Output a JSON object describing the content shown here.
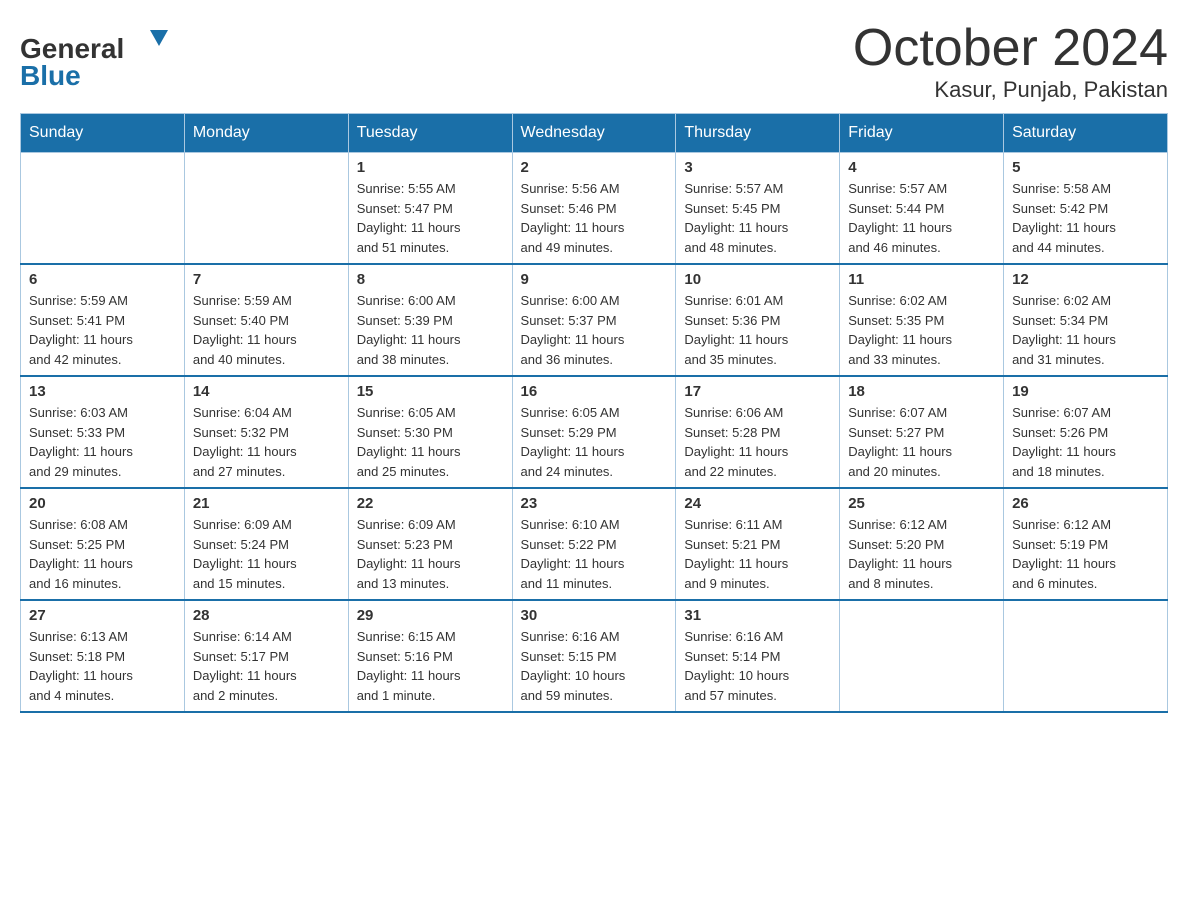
{
  "header": {
    "logo_general": "General",
    "logo_blue": "Blue",
    "title": "October 2024",
    "subtitle": "Kasur, Punjab, Pakistan"
  },
  "days_of_week": [
    "Sunday",
    "Monday",
    "Tuesday",
    "Wednesday",
    "Thursday",
    "Friday",
    "Saturday"
  ],
  "weeks": [
    [
      {
        "day": "",
        "info": ""
      },
      {
        "day": "",
        "info": ""
      },
      {
        "day": "1",
        "info": "Sunrise: 5:55 AM\nSunset: 5:47 PM\nDaylight: 11 hours\nand 51 minutes."
      },
      {
        "day": "2",
        "info": "Sunrise: 5:56 AM\nSunset: 5:46 PM\nDaylight: 11 hours\nand 49 minutes."
      },
      {
        "day": "3",
        "info": "Sunrise: 5:57 AM\nSunset: 5:45 PM\nDaylight: 11 hours\nand 48 minutes."
      },
      {
        "day": "4",
        "info": "Sunrise: 5:57 AM\nSunset: 5:44 PM\nDaylight: 11 hours\nand 46 minutes."
      },
      {
        "day": "5",
        "info": "Sunrise: 5:58 AM\nSunset: 5:42 PM\nDaylight: 11 hours\nand 44 minutes."
      }
    ],
    [
      {
        "day": "6",
        "info": "Sunrise: 5:59 AM\nSunset: 5:41 PM\nDaylight: 11 hours\nand 42 minutes."
      },
      {
        "day": "7",
        "info": "Sunrise: 5:59 AM\nSunset: 5:40 PM\nDaylight: 11 hours\nand 40 minutes."
      },
      {
        "day": "8",
        "info": "Sunrise: 6:00 AM\nSunset: 5:39 PM\nDaylight: 11 hours\nand 38 minutes."
      },
      {
        "day": "9",
        "info": "Sunrise: 6:00 AM\nSunset: 5:37 PM\nDaylight: 11 hours\nand 36 minutes."
      },
      {
        "day": "10",
        "info": "Sunrise: 6:01 AM\nSunset: 5:36 PM\nDaylight: 11 hours\nand 35 minutes."
      },
      {
        "day": "11",
        "info": "Sunrise: 6:02 AM\nSunset: 5:35 PM\nDaylight: 11 hours\nand 33 minutes."
      },
      {
        "day": "12",
        "info": "Sunrise: 6:02 AM\nSunset: 5:34 PM\nDaylight: 11 hours\nand 31 minutes."
      }
    ],
    [
      {
        "day": "13",
        "info": "Sunrise: 6:03 AM\nSunset: 5:33 PM\nDaylight: 11 hours\nand 29 minutes."
      },
      {
        "day": "14",
        "info": "Sunrise: 6:04 AM\nSunset: 5:32 PM\nDaylight: 11 hours\nand 27 minutes."
      },
      {
        "day": "15",
        "info": "Sunrise: 6:05 AM\nSunset: 5:30 PM\nDaylight: 11 hours\nand 25 minutes."
      },
      {
        "day": "16",
        "info": "Sunrise: 6:05 AM\nSunset: 5:29 PM\nDaylight: 11 hours\nand 24 minutes."
      },
      {
        "day": "17",
        "info": "Sunrise: 6:06 AM\nSunset: 5:28 PM\nDaylight: 11 hours\nand 22 minutes."
      },
      {
        "day": "18",
        "info": "Sunrise: 6:07 AM\nSunset: 5:27 PM\nDaylight: 11 hours\nand 20 minutes."
      },
      {
        "day": "19",
        "info": "Sunrise: 6:07 AM\nSunset: 5:26 PM\nDaylight: 11 hours\nand 18 minutes."
      }
    ],
    [
      {
        "day": "20",
        "info": "Sunrise: 6:08 AM\nSunset: 5:25 PM\nDaylight: 11 hours\nand 16 minutes."
      },
      {
        "day": "21",
        "info": "Sunrise: 6:09 AM\nSunset: 5:24 PM\nDaylight: 11 hours\nand 15 minutes."
      },
      {
        "day": "22",
        "info": "Sunrise: 6:09 AM\nSunset: 5:23 PM\nDaylight: 11 hours\nand 13 minutes."
      },
      {
        "day": "23",
        "info": "Sunrise: 6:10 AM\nSunset: 5:22 PM\nDaylight: 11 hours\nand 11 minutes."
      },
      {
        "day": "24",
        "info": "Sunrise: 6:11 AM\nSunset: 5:21 PM\nDaylight: 11 hours\nand 9 minutes."
      },
      {
        "day": "25",
        "info": "Sunrise: 6:12 AM\nSunset: 5:20 PM\nDaylight: 11 hours\nand 8 minutes."
      },
      {
        "day": "26",
        "info": "Sunrise: 6:12 AM\nSunset: 5:19 PM\nDaylight: 11 hours\nand 6 minutes."
      }
    ],
    [
      {
        "day": "27",
        "info": "Sunrise: 6:13 AM\nSunset: 5:18 PM\nDaylight: 11 hours\nand 4 minutes."
      },
      {
        "day": "28",
        "info": "Sunrise: 6:14 AM\nSunset: 5:17 PM\nDaylight: 11 hours\nand 2 minutes."
      },
      {
        "day": "29",
        "info": "Sunrise: 6:15 AM\nSunset: 5:16 PM\nDaylight: 11 hours\nand 1 minute."
      },
      {
        "day": "30",
        "info": "Sunrise: 6:16 AM\nSunset: 5:15 PM\nDaylight: 10 hours\nand 59 minutes."
      },
      {
        "day": "31",
        "info": "Sunrise: 6:16 AM\nSunset: 5:14 PM\nDaylight: 10 hours\nand 57 minutes."
      },
      {
        "day": "",
        "info": ""
      },
      {
        "day": "",
        "info": ""
      }
    ]
  ]
}
